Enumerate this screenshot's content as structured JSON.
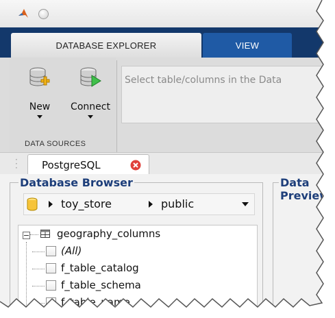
{
  "tabs": {
    "database_explorer": "DATABASE EXPLORER",
    "view": "VIEW"
  },
  "toolstrip": {
    "new_label": "New",
    "connect_label": "Connect",
    "section_label": "DATA SOURCES",
    "info_text": "Select table/columns in the Data"
  },
  "document_tab": {
    "label": "PostgreSQL"
  },
  "browser": {
    "title": "Database Browser",
    "path": [
      "toy_store",
      "public"
    ],
    "tree": {
      "table": "geography_columns",
      "columns": [
        "(All)",
        "f_table_catalog",
        "f_table_schema",
        "f_table_name"
      ]
    }
  },
  "preview": {
    "title": "Data Preview"
  },
  "colors": {
    "tabstrip": "#13386b",
    "view_tab": "#1f5aa5",
    "group_title": "#1d3e7a",
    "close_icon": "#e0403b"
  },
  "icons": [
    "matlab-logo",
    "minimize-button",
    "new-database-icon",
    "connect-database-icon",
    "close-tab-icon",
    "database-icon",
    "table-icon"
  ]
}
